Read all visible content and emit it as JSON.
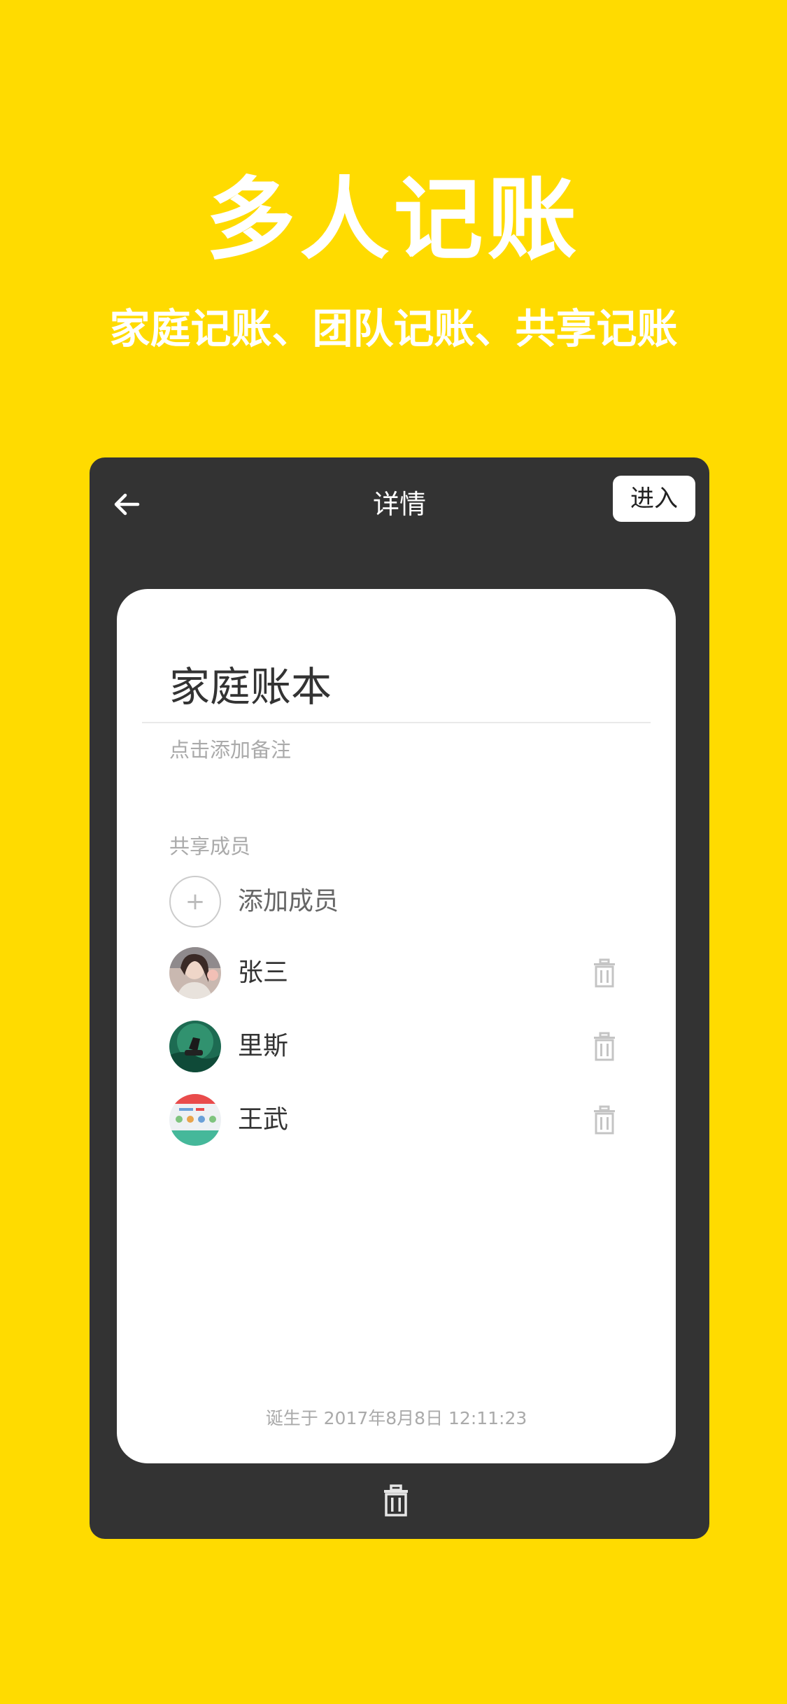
{
  "promo": {
    "headline": "多人记账",
    "subline": "家庭记账、团队记账、共享记账"
  },
  "nav": {
    "back_icon": "arrow-left-icon",
    "title": "详情",
    "enter_label": "进入"
  },
  "book": {
    "title": "家庭账本",
    "note_placeholder": "点击添加备注",
    "members_label": "共享成员",
    "add_member_icon": "plus-icon",
    "add_member_label": "添加成员",
    "members": [
      {
        "name": "张三",
        "avatar": "avatar-photo-woman"
      },
      {
        "name": "里斯",
        "avatar": "avatar-green-forest"
      },
      {
        "name": "王武",
        "avatar": "avatar-app-screenshot"
      }
    ],
    "created_at": "诞生于 2017年8月8日 12:11:23"
  },
  "colors": {
    "background": "#FFDB00",
    "phone": "#333333",
    "card": "#FFFFFF",
    "muted_text": "#AAAAAA",
    "icon_grey": "#BBBBBB"
  }
}
